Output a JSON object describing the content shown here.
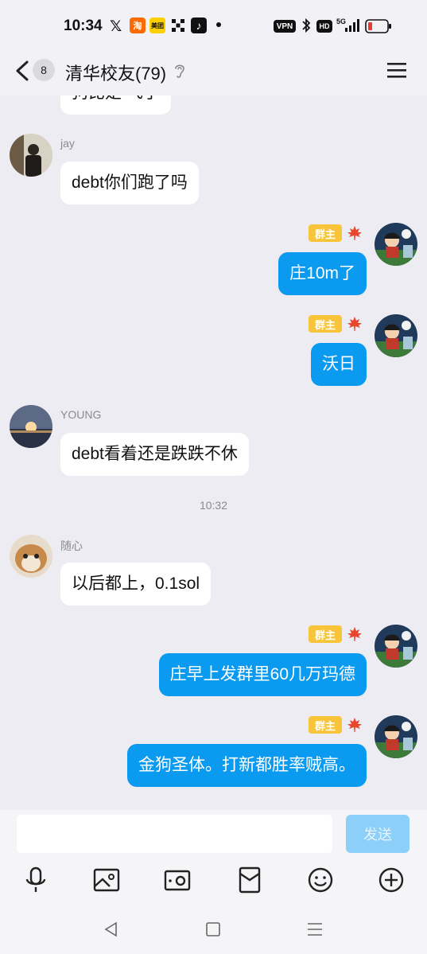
{
  "status_bar": {
    "time": "10:34",
    "app_icons": [
      "x-icon",
      "taobao-icon",
      "meituan-icon",
      "okx-icon",
      "tiktok-icon"
    ],
    "taobao_label": "淘",
    "meituan_label": "美团",
    "vpn": "VPN",
    "hd": "HD",
    "network": "5G"
  },
  "header": {
    "unread_count": "8",
    "title": "清华校友(79)"
  },
  "messages": {
    "m0_text": "狗比是 飞了",
    "m1_name": "jay",
    "m1_text": "debt你们跑了吗",
    "m2_badge": "群主",
    "m2_text": "庄10m了",
    "m3_badge": "群主",
    "m3_text": "沃日",
    "m4_name": "YOUNG",
    "m4_text": "debt看着还是跌跌不休",
    "timestamp": "10:32",
    "m5_name": "随心",
    "m5_text": "以后都上，0.1sol",
    "m6_badge": "群主",
    "m6_text": "庄早上发群里60几万玛德",
    "m7_badge": "群主",
    "m7_text": "金狗圣体。打新都胜率贼高。"
  },
  "input": {
    "placeholder": "",
    "send_label": "发送"
  },
  "colors": {
    "self_bubble": "#0a9af0",
    "other_bubble": "#ffffff",
    "owner_badge": "#f8c53a",
    "background": "#ececf2"
  }
}
